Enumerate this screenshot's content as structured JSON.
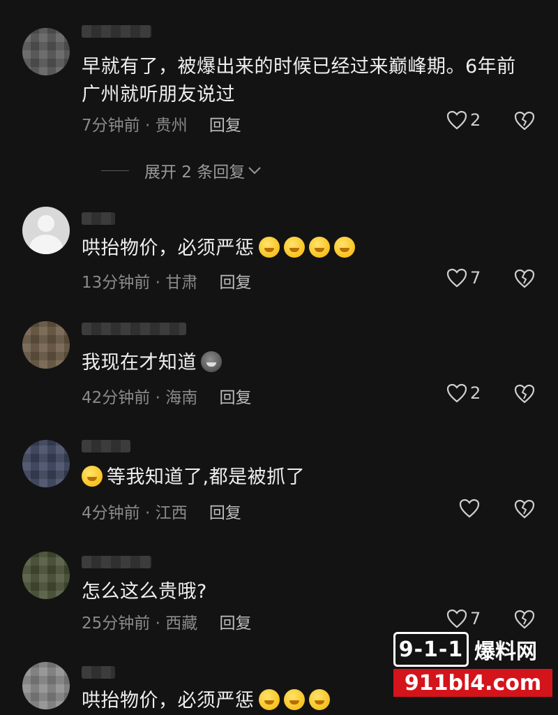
{
  "comments": [
    {
      "text": "早就有了，被爆出来的时候已经过来巅峰期。6年前广州就听朋友说过",
      "time": "7分钟前",
      "location": "贵州",
      "reply_label": "回复",
      "likes": "2",
      "expand": "展开 2 条回复"
    },
    {
      "text": "哄抬物价，必须严惩",
      "emojis": 4,
      "time": "13分钟前",
      "location": "甘肃",
      "reply_label": "回复",
      "likes": "7"
    },
    {
      "text": "我现在才知道",
      "emoji_icon": "cat-emoji",
      "time": "42分钟前",
      "location": "海南",
      "reply_label": "回复",
      "likes": "2"
    },
    {
      "text": "等我知道了,都是被抓了",
      "emoji_icon": "sweat-smile-emoji",
      "time": "4分钟前",
      "location": "江西",
      "reply_label": "回复",
      "likes": ""
    },
    {
      "text": "怎么这么贵哦?",
      "time": "25分钟前",
      "location": "西藏",
      "reply_label": "回复",
      "likes": "7"
    },
    {
      "text": "哄抬物价，必须严惩"
    }
  ],
  "watermark": {
    "logo": "9-1-1",
    "name": "爆料网",
    "url": "911bl4.com"
  },
  "colors": {
    "background": "#131313",
    "watermark_red": "#d4141b"
  }
}
